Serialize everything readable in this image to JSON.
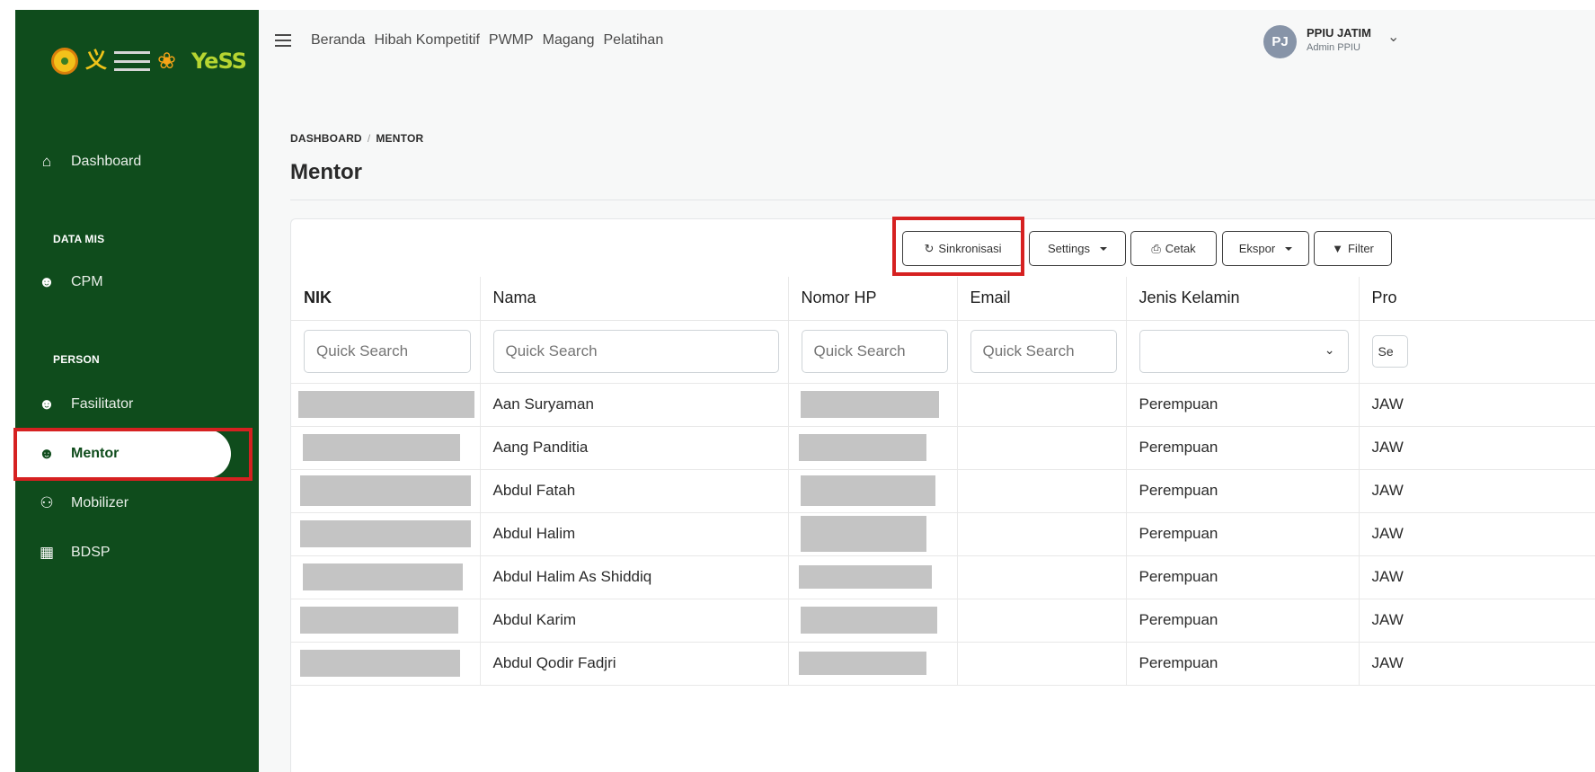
{
  "brand": {
    "logo_text": "YeSS"
  },
  "sidebar": {
    "items": [
      {
        "label": "Dashboard",
        "icon": "home-icon"
      },
      {
        "label": "CPM",
        "icon": "user-clock-icon"
      },
      {
        "label": "Fasilitator",
        "icon": "user-plus-icon"
      },
      {
        "label": "Mentor",
        "icon": "user-tie-icon"
      },
      {
        "label": "Mobilizer",
        "icon": "users-icon"
      },
      {
        "label": "BDSP",
        "icon": "building-icon"
      }
    ],
    "sections": [
      "DATA MIS",
      "PERSON"
    ]
  },
  "topnav": {
    "links": [
      "Beranda",
      "Hibah Kompetitif",
      "PWMP",
      "Magang",
      "Pelatihan"
    ]
  },
  "user": {
    "initials": "PJ",
    "name": "PPIU JATIM",
    "role": "Admin PPIU"
  },
  "breadcrumb": {
    "parent": "DASHBOARD",
    "sep": "/",
    "current": "MENTOR"
  },
  "page": {
    "title": "Mentor"
  },
  "toolbar": {
    "sync": "Sinkronisasi",
    "settings": "Settings",
    "print": "Cetak",
    "export": "Ekspor",
    "filter": "Filter"
  },
  "table": {
    "columns": [
      "NIK",
      "Nama",
      "Nomor HP",
      "Email",
      "Jenis Kelamin",
      "Pro"
    ],
    "search_placeholder": "Quick Search",
    "search_truncated": "Quick Search",
    "last_col_filter": "Se",
    "rows": [
      {
        "nama": "Aan Suryaman",
        "gender": "Perempuan",
        "prov": "JAW"
      },
      {
        "nama": "Aang Panditia",
        "gender": "Perempuan",
        "prov": "JAW"
      },
      {
        "nama": "Abdul Fatah",
        "gender": "Perempuan",
        "prov": "JAW"
      },
      {
        "nama": "Abdul Halim",
        "gender": "Perempuan",
        "prov": "JAW"
      },
      {
        "nama": "Abdul Halim As Shiddiq",
        "gender": "Perempuan",
        "prov": "JAW"
      },
      {
        "nama": "Abdul Karim",
        "gender": "Perempuan",
        "prov": "JAW"
      },
      {
        "nama": "Abdul Qodir Fadjri",
        "gender": "Perempuan",
        "prov": "JAW"
      }
    ]
  },
  "colors": {
    "sidebar": "#0f4c1c",
    "highlight": "#d62121",
    "redaction": "#c4c4c4"
  }
}
